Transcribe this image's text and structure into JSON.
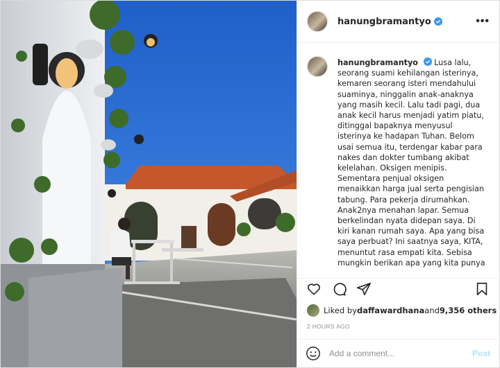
{
  "post": {
    "username": "hanungbramantyo",
    "verified": true,
    "caption": "Lusa lalu,\nseorang suami kehilangan isterinya,\nkemaren seorang isteri mendahului\nsuaminya, ninggalin anak-anaknya\nyang masih kecil. Lalu tadi pagi, dua\nanak kecil harus menjadi yatim piatu,\nditinggal bapaknya menyusul\nisterinya ke hadapan Tuhan. Belom\nusai semua itu, terdengar kabar para\nnakes dan dokter tumbang akibat\nkelelahan. Oksigen menipis.\nSementara penjual oksigen\nmenaikkan harga jual serta pengisian\ntabung. Para pekerja dirumahkan.\nAnak2nya menahan lapar. Semua\nberkelindan nyata didepan saya. Di\nkiri kanan rumah saya. Apa yang bisa\nsaya perbuat? Ini saatnya saya, KITA,\nmenuntut rasa empati kita. Sebisa\nmungkin berikan apa yang kita punya",
    "likes_prefix": "Liked by ",
    "liked_by_user": "daffawardhana",
    "likes_joiner": " and ",
    "likes_count": "9,356 others",
    "time_ago": "2 HOURS AGO",
    "more_label": "•••"
  },
  "comment_box": {
    "placeholder": "Add a comment...",
    "post_label": "Post"
  },
  "icons": {
    "like": "heart-icon",
    "comment": "comment-icon",
    "share": "paper-plane-icon",
    "save": "bookmark-icon",
    "emoji": "smiley-icon",
    "verified": "verified-badge-icon"
  },
  "colors": {
    "verified": "#3897f0",
    "post_disabled": "#b2dffc",
    "muted": "#8e8e8e",
    "sky": "#2f6fd4"
  }
}
